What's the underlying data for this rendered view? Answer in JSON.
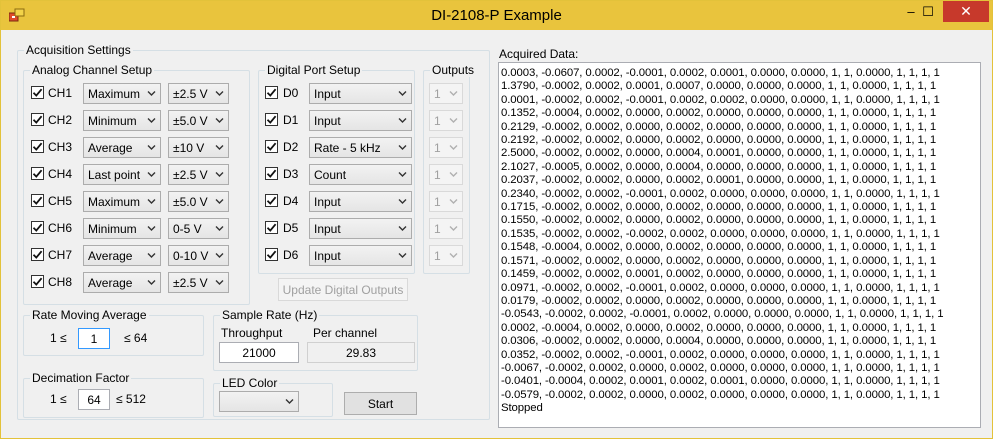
{
  "window": {
    "title": "DI-2108-P Example",
    "minimize": "–",
    "maximize": "☐",
    "close": "✕"
  },
  "acquisition": {
    "title": "Acquisition Settings",
    "analog": {
      "title": "Analog Channel Setup",
      "channels": [
        {
          "name": "CH1",
          "checked": true,
          "mode": "Maximum",
          "range": "±2.5 V"
        },
        {
          "name": "CH2",
          "checked": true,
          "mode": "Minimum",
          "range": "±5.0 V"
        },
        {
          "name": "CH3",
          "checked": true,
          "mode": "Average",
          "range": "±10 V"
        },
        {
          "name": "CH4",
          "checked": true,
          "mode": "Last point",
          "range": "±2.5 V"
        },
        {
          "name": "CH5",
          "checked": true,
          "mode": "Maximum",
          "range": "±5.0 V"
        },
        {
          "name": "CH6",
          "checked": true,
          "mode": "Minimum",
          "range": "0-5 V"
        },
        {
          "name": "CH7",
          "checked": true,
          "mode": "Average",
          "range": "0-10 V"
        },
        {
          "name": "CH8",
          "checked": true,
          "mode": "Average",
          "range": "±2.5 V"
        }
      ]
    },
    "digital": {
      "title": "Digital Port Setup",
      "ports": [
        {
          "name": "D0",
          "checked": true,
          "mode": "Input"
        },
        {
          "name": "D1",
          "checked": true,
          "mode": "Input"
        },
        {
          "name": "D2",
          "checked": true,
          "mode": "Rate - 5 kHz"
        },
        {
          "name": "D3",
          "checked": true,
          "mode": "Count"
        },
        {
          "name": "D4",
          "checked": true,
          "mode": "Input"
        },
        {
          "name": "D5",
          "checked": true,
          "mode": "Input"
        },
        {
          "name": "D6",
          "checked": true,
          "mode": "Input"
        }
      ],
      "update_button": "Update Digital Outputs"
    },
    "outputs": {
      "title": "Outputs",
      "values": [
        "1",
        "1",
        "1",
        "1",
        "1",
        "1",
        "1"
      ]
    },
    "rate_moving_average": {
      "title": "Rate Moving Average",
      "min_label": "1 ≤",
      "value": "1",
      "max_label": "≤ 64"
    },
    "sample_rate": {
      "title": "Sample Rate (Hz)",
      "throughput_label": "Throughput",
      "throughput_value": "21000",
      "per_channel_label": "Per channel",
      "per_channel_value": "29.83"
    },
    "decimation": {
      "title": "Decimation Factor",
      "min_label": "1 ≤",
      "value": "64",
      "max_label": "≤ 512"
    },
    "led_color": {
      "title": "LED Color",
      "value": ""
    },
    "start_button": "Start"
  },
  "acquired": {
    "title": "Acquired Data:",
    "lines": [
      "0.0003, -0.0607, 0.0002, -0.0001, 0.0002, 0.0001, 0.0000, 0.0000, 1, 1, 0.0000, 1, 1, 1, 1",
      "1.3790, -0.0002, 0.0002, 0.0001, 0.0007, 0.0000, 0.0000, 0.0000, 1, 1, 0.0000, 1, 1, 1, 1",
      "0.0001, -0.0002, 0.0002, -0.0001, 0.0002, 0.0002, 0.0000, 0.0000, 1, 1, 0.0000, 1, 1, 1, 1",
      "0.1352, -0.0004, 0.0002, 0.0000, 0.0002, 0.0000, 0.0000, 0.0000, 1, 1, 0.0000, 1, 1, 1, 1",
      "0.2129, -0.0002, 0.0002, 0.0000, 0.0002, 0.0000, 0.0000, 0.0000, 1, 1, 0.0000, 1, 1, 1, 1",
      "0.2192, -0.0002, 0.0002, 0.0000, 0.0002, 0.0000, 0.0000, 0.0000, 1, 1, 0.0000, 1, 1, 1, 1",
      "2.5000, -0.0002, 0.0002, 0.0000, 0.0004, 0.0001, 0.0000, 0.0000, 1, 1, 0.0000, 1, 1, 1, 1",
      "2.1027, -0.0005, 0.0002, 0.0000, 0.0004, 0.0000, 0.0000, 0.0000, 1, 1, 0.0000, 1, 1, 1, 1",
      "0.2037, -0.0002, 0.0002, 0.0000, 0.0002, 0.0001, 0.0000, 0.0000, 1, 1, 0.0000, 1, 1, 1, 1",
      "0.2340, -0.0002, 0.0002, -0.0001, 0.0002, 0.0000, 0.0000, 0.0000, 1, 1, 0.0000, 1, 1, 1, 1",
      "0.1715, -0.0002, 0.0002, 0.0000, 0.0002, 0.0000, 0.0000, 0.0000, 1, 1, 0.0000, 1, 1, 1, 1",
      "0.1550, -0.0002, 0.0002, 0.0000, 0.0002, 0.0000, 0.0000, 0.0000, 1, 1, 0.0000, 1, 1, 1, 1",
      "0.1535, -0.0002, 0.0002, -0.0002, 0.0002, 0.0000, 0.0000, 0.0000, 1, 1, 0.0000, 1, 1, 1, 1",
      "0.1548, -0.0004, 0.0002, 0.0000, 0.0002, 0.0000, 0.0000, 0.0000, 1, 1, 0.0000, 1, 1, 1, 1",
      "0.1571, -0.0002, 0.0002, 0.0000, 0.0002, 0.0000, 0.0000, 0.0000, 1, 1, 0.0000, 1, 1, 1, 1",
      "0.1459, -0.0002, 0.0002, 0.0001, 0.0002, 0.0000, 0.0000, 0.0000, 1, 1, 0.0000, 1, 1, 1, 1",
      "0.0971, -0.0002, 0.0002, -0.0001, 0.0002, 0.0000, 0.0000, 0.0000, 1, 1, 0.0000, 1, 1, 1, 1",
      "0.0179, -0.0002, 0.0002, 0.0000, 0.0002, 0.0000, 0.0000, 0.0000, 1, 1, 0.0000, 1, 1, 1, 1",
      "-0.0543, -0.0002, 0.0002, -0.0001, 0.0002, 0.0000, 0.0000, 0.0000, 1, 1, 0.0000, 1, 1, 1, 1",
      "0.0002, -0.0004, 0.0002, 0.0000, 0.0002, 0.0000, 0.0000, 0.0000, 1, 1, 0.0000, 1, 1, 1, 1",
      "0.0306, -0.0002, 0.0002, 0.0000, 0.0004, 0.0000, 0.0000, 0.0000, 1, 1, 0.0000, 1, 1, 1, 1",
      "0.0352, -0.0002, 0.0002, -0.0001, 0.0002, 0.0000, 0.0000, 0.0000, 1, 1, 0.0000, 1, 1, 1, 1",
      "-0.0067, -0.0002, 0.0002, 0.0000, 0.0002, 0.0000, 0.0000, 0.0000, 1, 1, 0.0000, 1, 1, 1, 1",
      "-0.0401, -0.0004, 0.0002, 0.0001, 0.0002, 0.0001, 0.0000, 0.0000, 1, 1, 0.0000, 1, 1, 1, 1",
      "-0.0579, -0.0002, 0.0002, 0.0000, 0.0002, 0.0000, 0.0000, 0.0000, 1, 1, 0.0000, 1, 1, 1, 1",
      "Stopped"
    ]
  }
}
